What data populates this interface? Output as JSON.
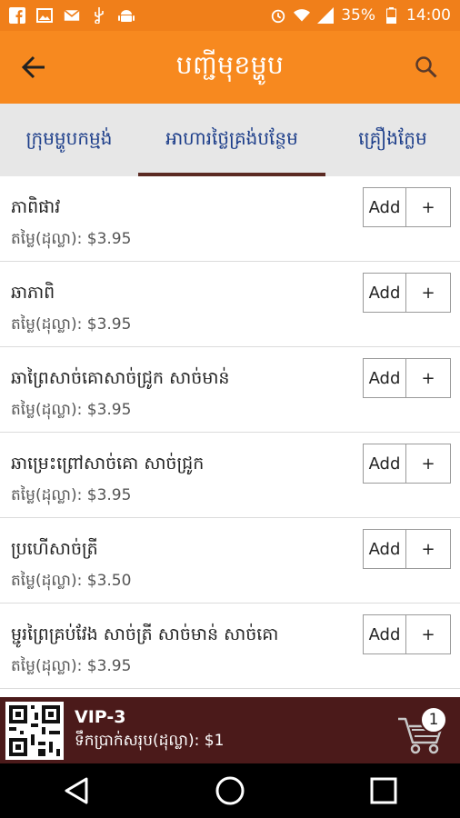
{
  "status_bar": {
    "battery": "35%",
    "time": "14:00",
    "icons": [
      "facebook-icon",
      "image-icon",
      "gmail-icon",
      "usb-icon",
      "android-icon",
      "alarm-icon",
      "wifi-icon",
      "signal-icon",
      "battery-icon"
    ]
  },
  "app_bar": {
    "title": "បញ្ជីមុខម្ហូប"
  },
  "tabs": [
    {
      "label": "ក្រុមម្ហូបកម្មង់",
      "active": false
    },
    {
      "label": "អាហារថ្លៃគ្រង់បន្ថែម",
      "active": true
    },
    {
      "label": "គ្រឿងក្លែម",
      "active": false
    }
  ],
  "items": [
    {
      "name": "ភាពិផាវ",
      "price": "តម្លៃ(ដុល្លា): $3.95",
      "add_label": "Add",
      "plus_label": "+"
    },
    {
      "name": "ឆាភាពិ",
      "price": "តម្លៃ(ដុល្លា): $3.95",
      "add_label": "Add",
      "plus_label": "+"
    },
    {
      "name": "ឆាព្រៃសាច់គោសាច់ជ្រូក សាច់មាន់",
      "price": "តម្លៃ(ដុល្លា): $3.95",
      "add_label": "Add",
      "plus_label": "+"
    },
    {
      "name": "ឆាម្រេះព្រៅសាច់គោ សាច់ជ្រូក",
      "price": "តម្លៃ(ដុល្លា): $3.95",
      "add_label": "Add",
      "plus_label": "+"
    },
    {
      "name": "ប្រហើសាច់ត្រី",
      "price": "តម្លៃ(ដុល្លា): $3.50",
      "add_label": "Add",
      "plus_label": "+"
    },
    {
      "name": "ម្ជូរព្រៃគ្រប់វែង សាច់ត្រី សាច់មាន់ សាច់គោ",
      "price": "តម្លៃ(ដុល្លា): $3.95",
      "add_label": "Add",
      "plus_label": "+"
    }
  ],
  "bottom_bar": {
    "table_name": "VIP-3",
    "total": "ទឹកប្រាក់សរុប(ដុល្លា): $1",
    "cart_count": "1"
  },
  "colors": {
    "status_bar": "#f07f1a",
    "app_bar": "#f7891f",
    "tab_bg": "#e7e7e7",
    "tab_text": "#1d3e8a",
    "tab_indicator": "#5b2a23",
    "bottom_bar": "#4b1a1a"
  }
}
